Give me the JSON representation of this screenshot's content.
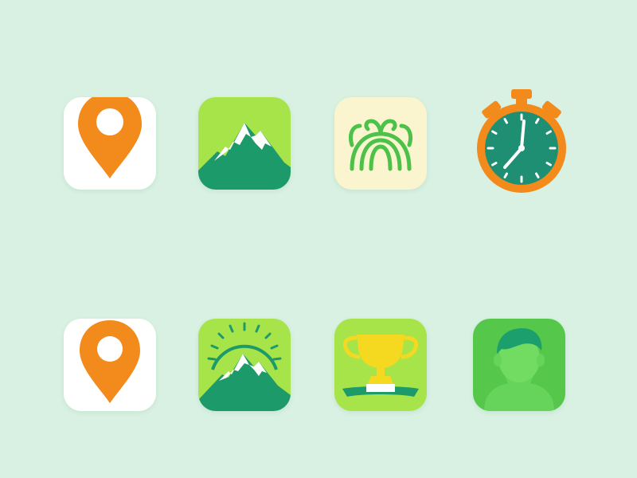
{
  "background": "#d8f1e2",
  "colors": {
    "orange": "#f28a1c",
    "white_tile": "#ffffff",
    "lime": "#a6e44a",
    "mountain_green": "#1d9a6a",
    "snow": "#ffffff",
    "cream": "#fbf5cf",
    "sprout_green": "#4cc24a",
    "clock_face": "#1f8f73",
    "trophy_gold": "#f5d820",
    "avatar_green": "#66d35a",
    "avatar_dark": "#1c9f6c"
  },
  "icons": [
    {
      "name": "location-pin-icon"
    },
    {
      "name": "mountain-icon"
    },
    {
      "name": "sprout-arches-icon"
    },
    {
      "name": "stopwatch-icon"
    },
    {
      "name": "location-pin-icon"
    },
    {
      "name": "mountain-compass-icon"
    },
    {
      "name": "trophy-icon"
    },
    {
      "name": "user-avatar-icon"
    }
  ]
}
